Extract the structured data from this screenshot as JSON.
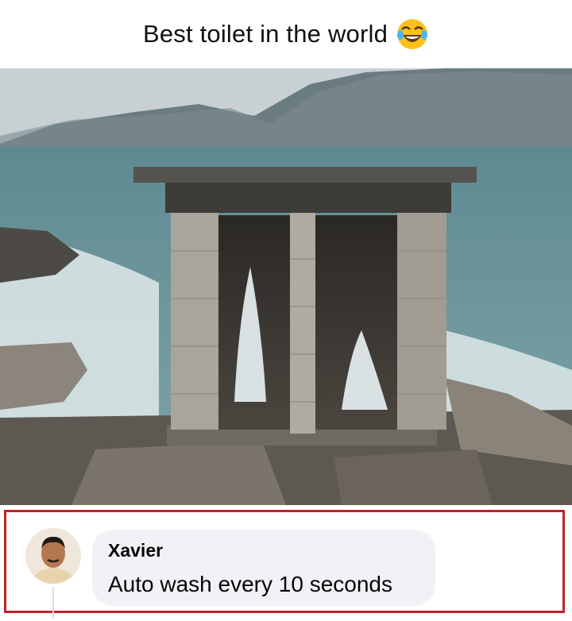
{
  "post": {
    "caption": "Best toilet in the world",
    "caption_emoji": "face-with-tears-of-joy"
  },
  "photo": {
    "description_icon": "outdoor-brick-toilet-photo"
  },
  "comment": {
    "author": "Xavier",
    "text": "Auto wash every 10 seconds",
    "highlight_color": "#c0222b",
    "bubble_color": "#f0f2f5"
  }
}
